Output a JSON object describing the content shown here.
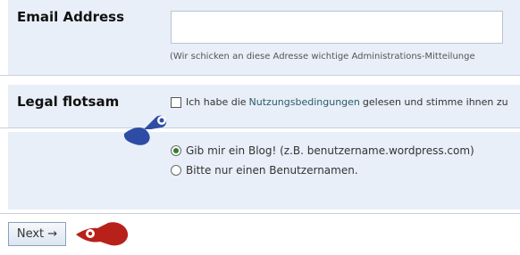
{
  "form": {
    "email": {
      "label": "Email Address",
      "value": "",
      "help": "(Wir schicken an diese Adresse wichtige Administrations-Mitteilunge"
    },
    "legal": {
      "label": "Legal flotsam",
      "prefix": "Ich habe die",
      "link": "Nutzungsbedingungen",
      "suffix": "gelesen und stimme ihnen zu"
    },
    "blog_choice": {
      "option_1": "Gib mir ein Blog! (z.B. benutzername.wordpress.com)",
      "option_2": "Bitte nur einen Benutzernamen.",
      "selected": "option_1"
    },
    "next_button": "Next →"
  },
  "annotation": {
    "blue_marker": "blue-pushpin-mark-icon",
    "red_marker": "red-pushpin-mark-icon",
    "blue_color": "#2f4ca5",
    "red_color": "#b8201a"
  }
}
